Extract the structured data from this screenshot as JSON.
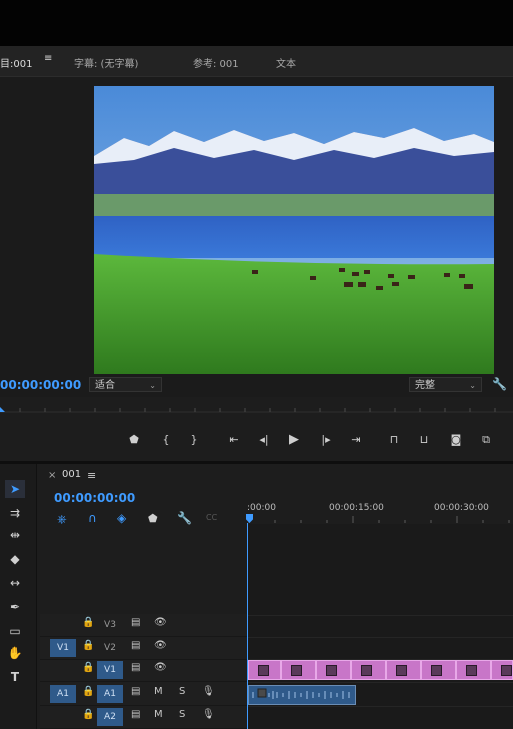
{
  "tabs": [
    {
      "label": "目:001",
      "active": true
    },
    {
      "label": "字幕: (无字幕)"
    },
    {
      "label": "参考: 001"
    },
    {
      "label": "文本"
    }
  ],
  "program_monitor": {
    "timecode": "00:00:00:00",
    "fit_select": "适合",
    "quality_select": "完整"
  },
  "transport_icons": [
    "marker-icon",
    "in-point-icon",
    "out-point-icon",
    "go-to-in-icon",
    "step-back-icon",
    "play-icon",
    "step-forward-icon",
    "go-to-out-icon",
    "lift-icon",
    "extract-icon",
    "camera-icon",
    "compare-icon"
  ],
  "sequence": {
    "close_glyph": "×",
    "name": "001",
    "menu_glyph": "≡",
    "timecode": "00:00:00:00",
    "ruler_labels": [
      ":00:00",
      "00:00:15:00",
      "00:00:30:00"
    ]
  },
  "tools": [
    "selection-tool-icon",
    "track-select-icon",
    "ripple-edit-icon",
    "razor-icon",
    "slip-icon",
    "pen-icon",
    "rectangle-icon",
    "hand-icon",
    "type-icon"
  ],
  "tracks": {
    "video": [
      {
        "name": "V3",
        "source": ""
      },
      {
        "name": "V2",
        "source": ""
      },
      {
        "name": "V1",
        "source": "V1"
      }
    ],
    "audio": [
      {
        "name": "A1",
        "source": "A1",
        "m": "M",
        "s": "S"
      },
      {
        "name": "A2",
        "source": "",
        "m": "M",
        "s": "S"
      }
    ]
  },
  "colors": {
    "accent": "#3f9bff",
    "video_clip": "#c876c8",
    "audio_clip": "#2f5a8a"
  }
}
